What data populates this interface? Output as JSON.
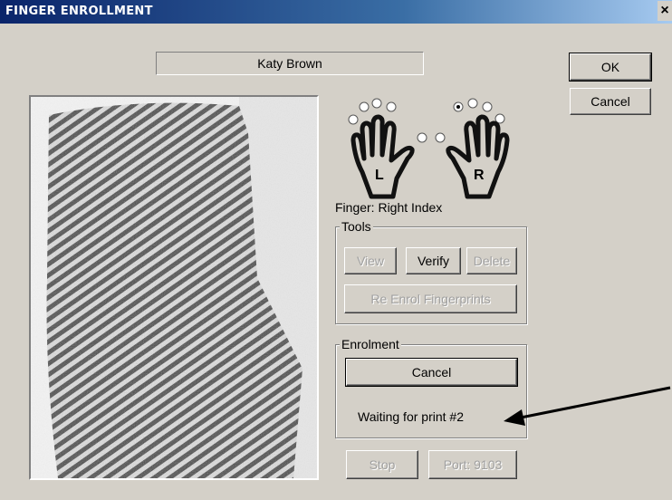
{
  "window": {
    "title": "FINGER ENROLLMENT",
    "close_label": "×"
  },
  "user": {
    "name": "Katy Brown"
  },
  "buttons": {
    "ok": "OK",
    "cancel": "Cancel"
  },
  "hands": {
    "left_letter": "L",
    "right_letter": "R",
    "selected_finger": "right-index"
  },
  "finger": {
    "label": "Finger:  Right Index"
  },
  "tools": {
    "group_label": "Tools",
    "view": "View",
    "verify": "Verify",
    "delete": "Delete",
    "reenrol": "Re Enrol Fingerprints"
  },
  "enrolment": {
    "group_label": "Enrolment",
    "cancel": "Cancel",
    "status": "Waiting for print #2"
  },
  "footer": {
    "stop": "Stop",
    "port": "Port: 9103"
  },
  "colors": {
    "face": "#d4d0c8",
    "title_start": "#0a246a",
    "disabled_text": "#a0a0a0"
  }
}
